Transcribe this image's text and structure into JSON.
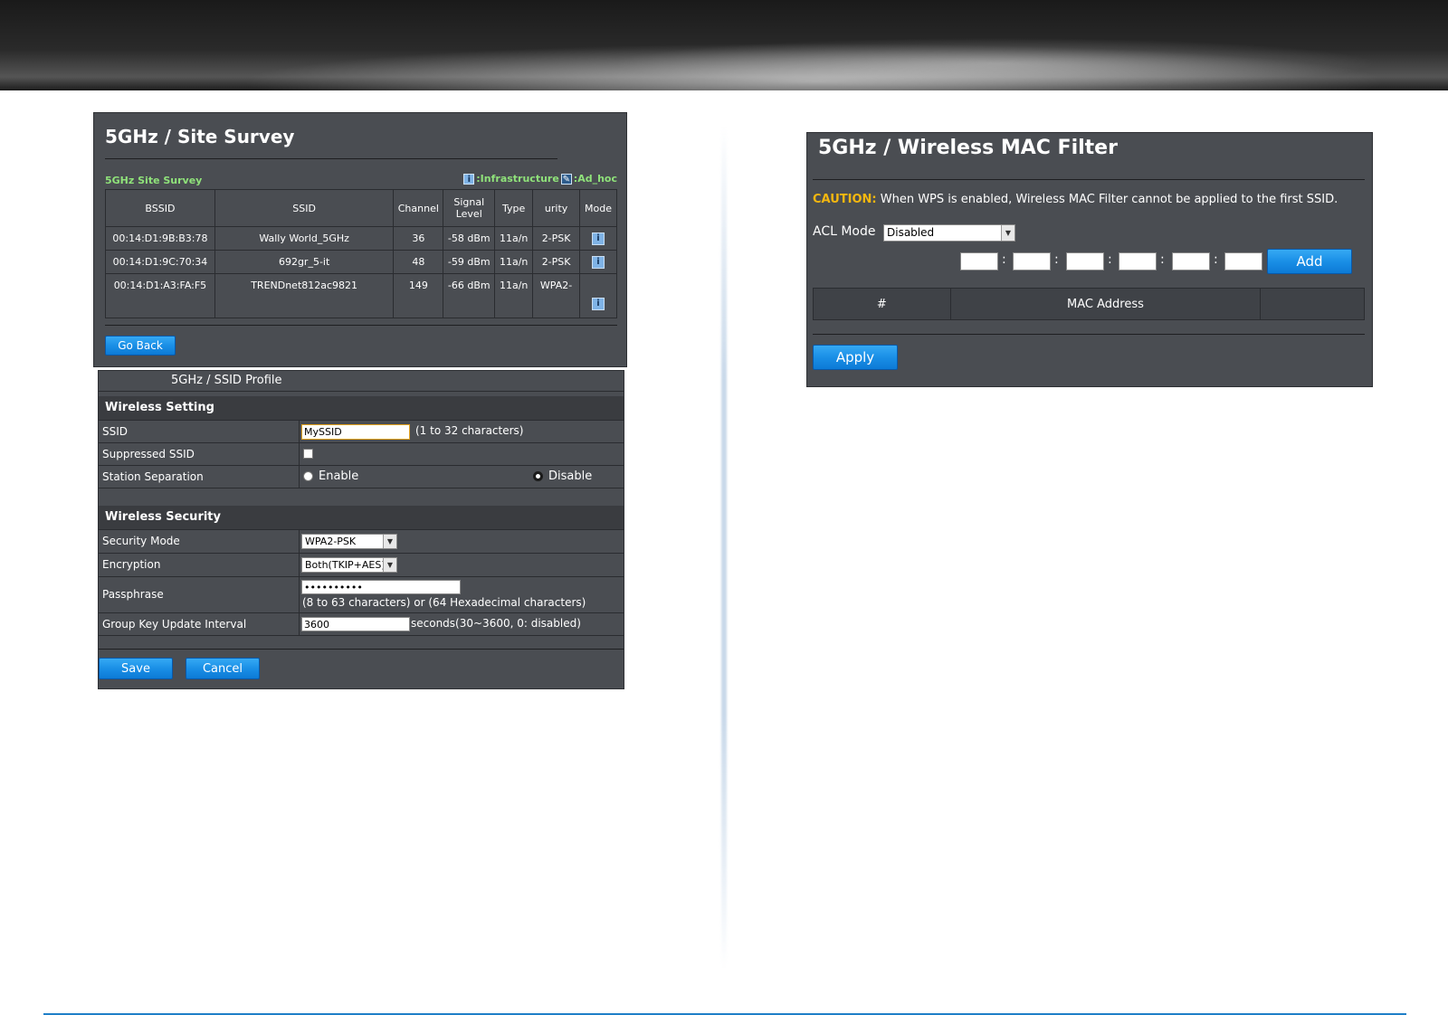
{
  "site_survey": {
    "title": "5GHz / Site Survey",
    "section_label": "5GHz Site Survey",
    "legend_infrastructure": ":Infrastructure",
    "legend_adhoc": ":Ad_hoc",
    "columns": [
      "BSSID",
      "SSID",
      "Channel",
      "Signal Level",
      "Type",
      "urity",
      "Mode"
    ],
    "rows": [
      {
        "bssid": "00:14:D1:9B:B3:78",
        "ssid": "Wally World_5GHz",
        "channel": "36",
        "signal": "-58 dBm",
        "type": "11a/n",
        "security": "2-PSK",
        "mode": "i"
      },
      {
        "bssid": "00:14:D1:9C:70:34",
        "ssid": "692gr_5-it",
        "channel": "48",
        "signal": "-59 dBm",
        "type": "11a/n",
        "security": "2-PSK",
        "mode": "i"
      },
      {
        "bssid": "00:14:D1:A3:FA:F5",
        "ssid": "TRENDnet812ac9821",
        "channel": "149",
        "signal": "-66 dBm",
        "type": "11a/n",
        "security": "WPA2-",
        "mode": "i"
      }
    ],
    "go_back_label": "Go Back"
  },
  "ssid_profile": {
    "header": "5GHz / SSID Profile",
    "wireless_setting_title": "Wireless Setting",
    "ssid_label": "SSID",
    "ssid_value": "MySSID",
    "ssid_hint": "(1 to 32 characters)",
    "suppressed_label": "Suppressed SSID",
    "station_sep_label": "Station Separation",
    "enable_label": "Enable",
    "disable_label": "Disable",
    "wireless_security_title": "Wireless Security",
    "security_mode_label": "Security Mode",
    "security_mode_value": "WPA2-PSK",
    "encryption_label": "Encryption",
    "encryption_value": "Both(TKIP+AES)",
    "passphrase_label": "Passphrase",
    "passphrase_value": "••••••••••",
    "passphrase_hint": "(8 to 63 characters) or (64 Hexadecimal characters)",
    "group_key_label": "Group Key Update Interval",
    "group_key_value": "3600",
    "group_key_hint": "seconds(30~3600, 0: disabled)",
    "save_label": "Save",
    "cancel_label": "Cancel"
  },
  "mac_filter": {
    "title": "5GHz / Wireless MAC Filter",
    "caution_prefix": "CAUTION:",
    "caution_text": " When WPS is enabled, Wireless MAC Filter cannot be applied to the first SSID.",
    "acl_label": "ACL Mode",
    "acl_value": "Disabled",
    "colon": ":",
    "add_label": "Add",
    "columns": [
      "#",
      "MAC Address",
      ""
    ],
    "apply_label": "Apply"
  },
  "colors": {
    "panel_bg": "#4a4d52",
    "button_blue": "#1a8fe6",
    "caution": "#f5b70f",
    "survey_green": "#8fe27a",
    "footer_line": "#1f7fc8"
  }
}
